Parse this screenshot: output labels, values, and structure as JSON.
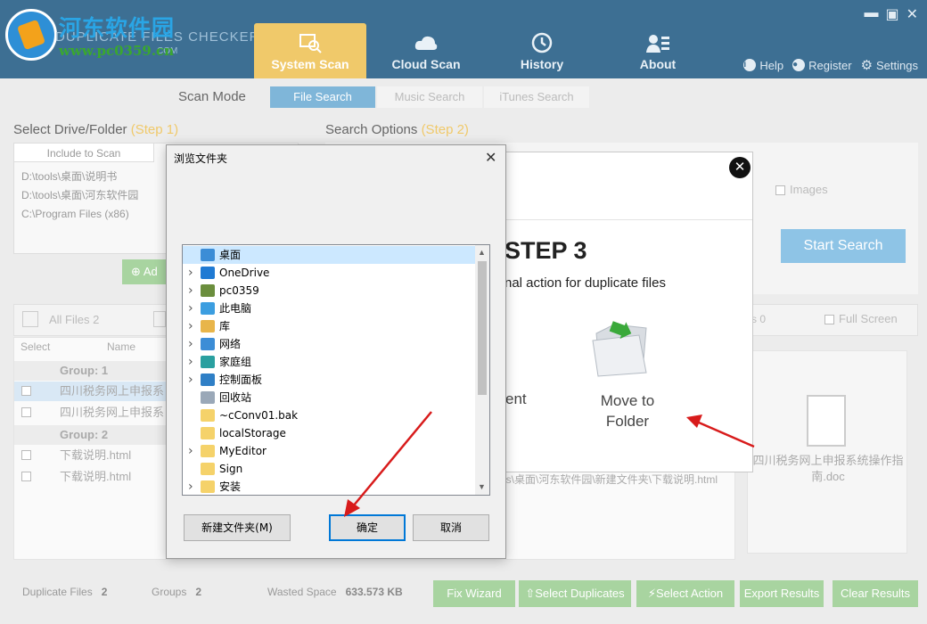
{
  "watermark": {
    "title": "河东软件园",
    "url": "www.pc0359.cn"
  },
  "app": {
    "name": "DUPLICATE FILES CHECKER",
    "sub": "COM"
  },
  "nav": [
    {
      "label": "System Scan",
      "icon": "scan-icon"
    },
    {
      "label": "Cloud Scan",
      "icon": "cloud-icon"
    },
    {
      "label": "History",
      "icon": "history-icon"
    },
    {
      "label": "About",
      "icon": "about-icon"
    }
  ],
  "header_links": {
    "help": "Help",
    "register": "Register",
    "settings": "Settings"
  },
  "scan_mode": {
    "label": "Scan Mode",
    "tabs": [
      "File Search",
      "Music Search",
      "iTunes Search"
    ]
  },
  "select_drive": {
    "title": "Select Drive/Folder",
    "step": "(Step 1)",
    "tab": "Include to Scan",
    "paths": [
      "D:\\tools\\桌面\\说明书",
      "D:\\tools\\桌面\\河东软件园",
      "C:\\Program Files (x86)"
    ],
    "add_label": "Ad"
  },
  "search_options": {
    "title": "Search Options",
    "step": "(Step 2)",
    "images_label": "Images",
    "start_label": "Start Search"
  },
  "results": {
    "all_files": "All Files 2",
    "s0": "s 0",
    "full_screen": "Full Screen",
    "col_select": "Select",
    "col_name": "Name",
    "groups": [
      {
        "label": "Group: 1",
        "files": [
          "四川税务网上申报系",
          "四川税务网上申报系"
        ]
      },
      {
        "label": "Group: 2",
        "files": [
          "下载说明.html",
          "下载说明.html"
        ]
      }
    ],
    "path_text": "ls\\桌面\\河东软件园\\新建文件夹\\下载说明.html",
    "preview_name": "四川税务网上申报系统操作指南.doc"
  },
  "footer": {
    "duplicate_label": "Duplicate Files",
    "duplicate_value": "2",
    "groups_label": "Groups",
    "groups_value": "2",
    "wasted_label": "Wasted Space",
    "wasted_value": "633.573 KB",
    "buttons": [
      "Fix Wizard",
      "Select Duplicates",
      "Select Action",
      "Export Results",
      "Clear Results"
    ]
  },
  "popup": {
    "step": "STEP 3",
    "desc": "nal action for duplicate files",
    "left_label": "ent",
    "move_label": "Move to Folder"
  },
  "dialog": {
    "title": "浏览文件夹",
    "tree": [
      {
        "label": "桌面",
        "icon": "desktop-icon",
        "color": "#3c8dd6",
        "arrow": false,
        "selected": true
      },
      {
        "label": "OneDrive",
        "icon": "onedrive-icon",
        "color": "#1f7ad3",
        "arrow": true
      },
      {
        "label": "pc0359",
        "icon": "user-icon",
        "color": "#6b8e3d",
        "arrow": true
      },
      {
        "label": "此电脑",
        "icon": "computer-icon",
        "color": "#3c9ee0",
        "arrow": true
      },
      {
        "label": "库",
        "icon": "library-icon",
        "color": "#e8b54a",
        "arrow": true
      },
      {
        "label": "网络",
        "icon": "network-icon",
        "color": "#3c8dd6",
        "arrow": true
      },
      {
        "label": "家庭组",
        "icon": "homegroup-icon",
        "color": "#2aa0a0",
        "arrow": true
      },
      {
        "label": "控制面板",
        "icon": "control-panel-icon",
        "color": "#2f7fc6",
        "arrow": true
      },
      {
        "label": "回收站",
        "icon": "recycle-bin-icon",
        "color": "#9aa8b8",
        "arrow": false
      },
      {
        "label": "~cConv01.bak",
        "icon": "folder-icon",
        "color": "#f5d26a",
        "arrow": false
      },
      {
        "label": "localStorage",
        "icon": "folder-icon",
        "color": "#f5d26a",
        "arrow": false
      },
      {
        "label": "MyEditor",
        "icon": "folder-icon",
        "color": "#f5d26a",
        "arrow": true
      },
      {
        "label": "Sign",
        "icon": "folder-icon",
        "color": "#f5d26a",
        "arrow": false
      },
      {
        "label": "安装",
        "icon": "folder-icon",
        "color": "#f5d26a",
        "arrow": true
      }
    ],
    "new_folder": "新建文件夹(M)",
    "ok": "确定",
    "cancel": "取消"
  }
}
